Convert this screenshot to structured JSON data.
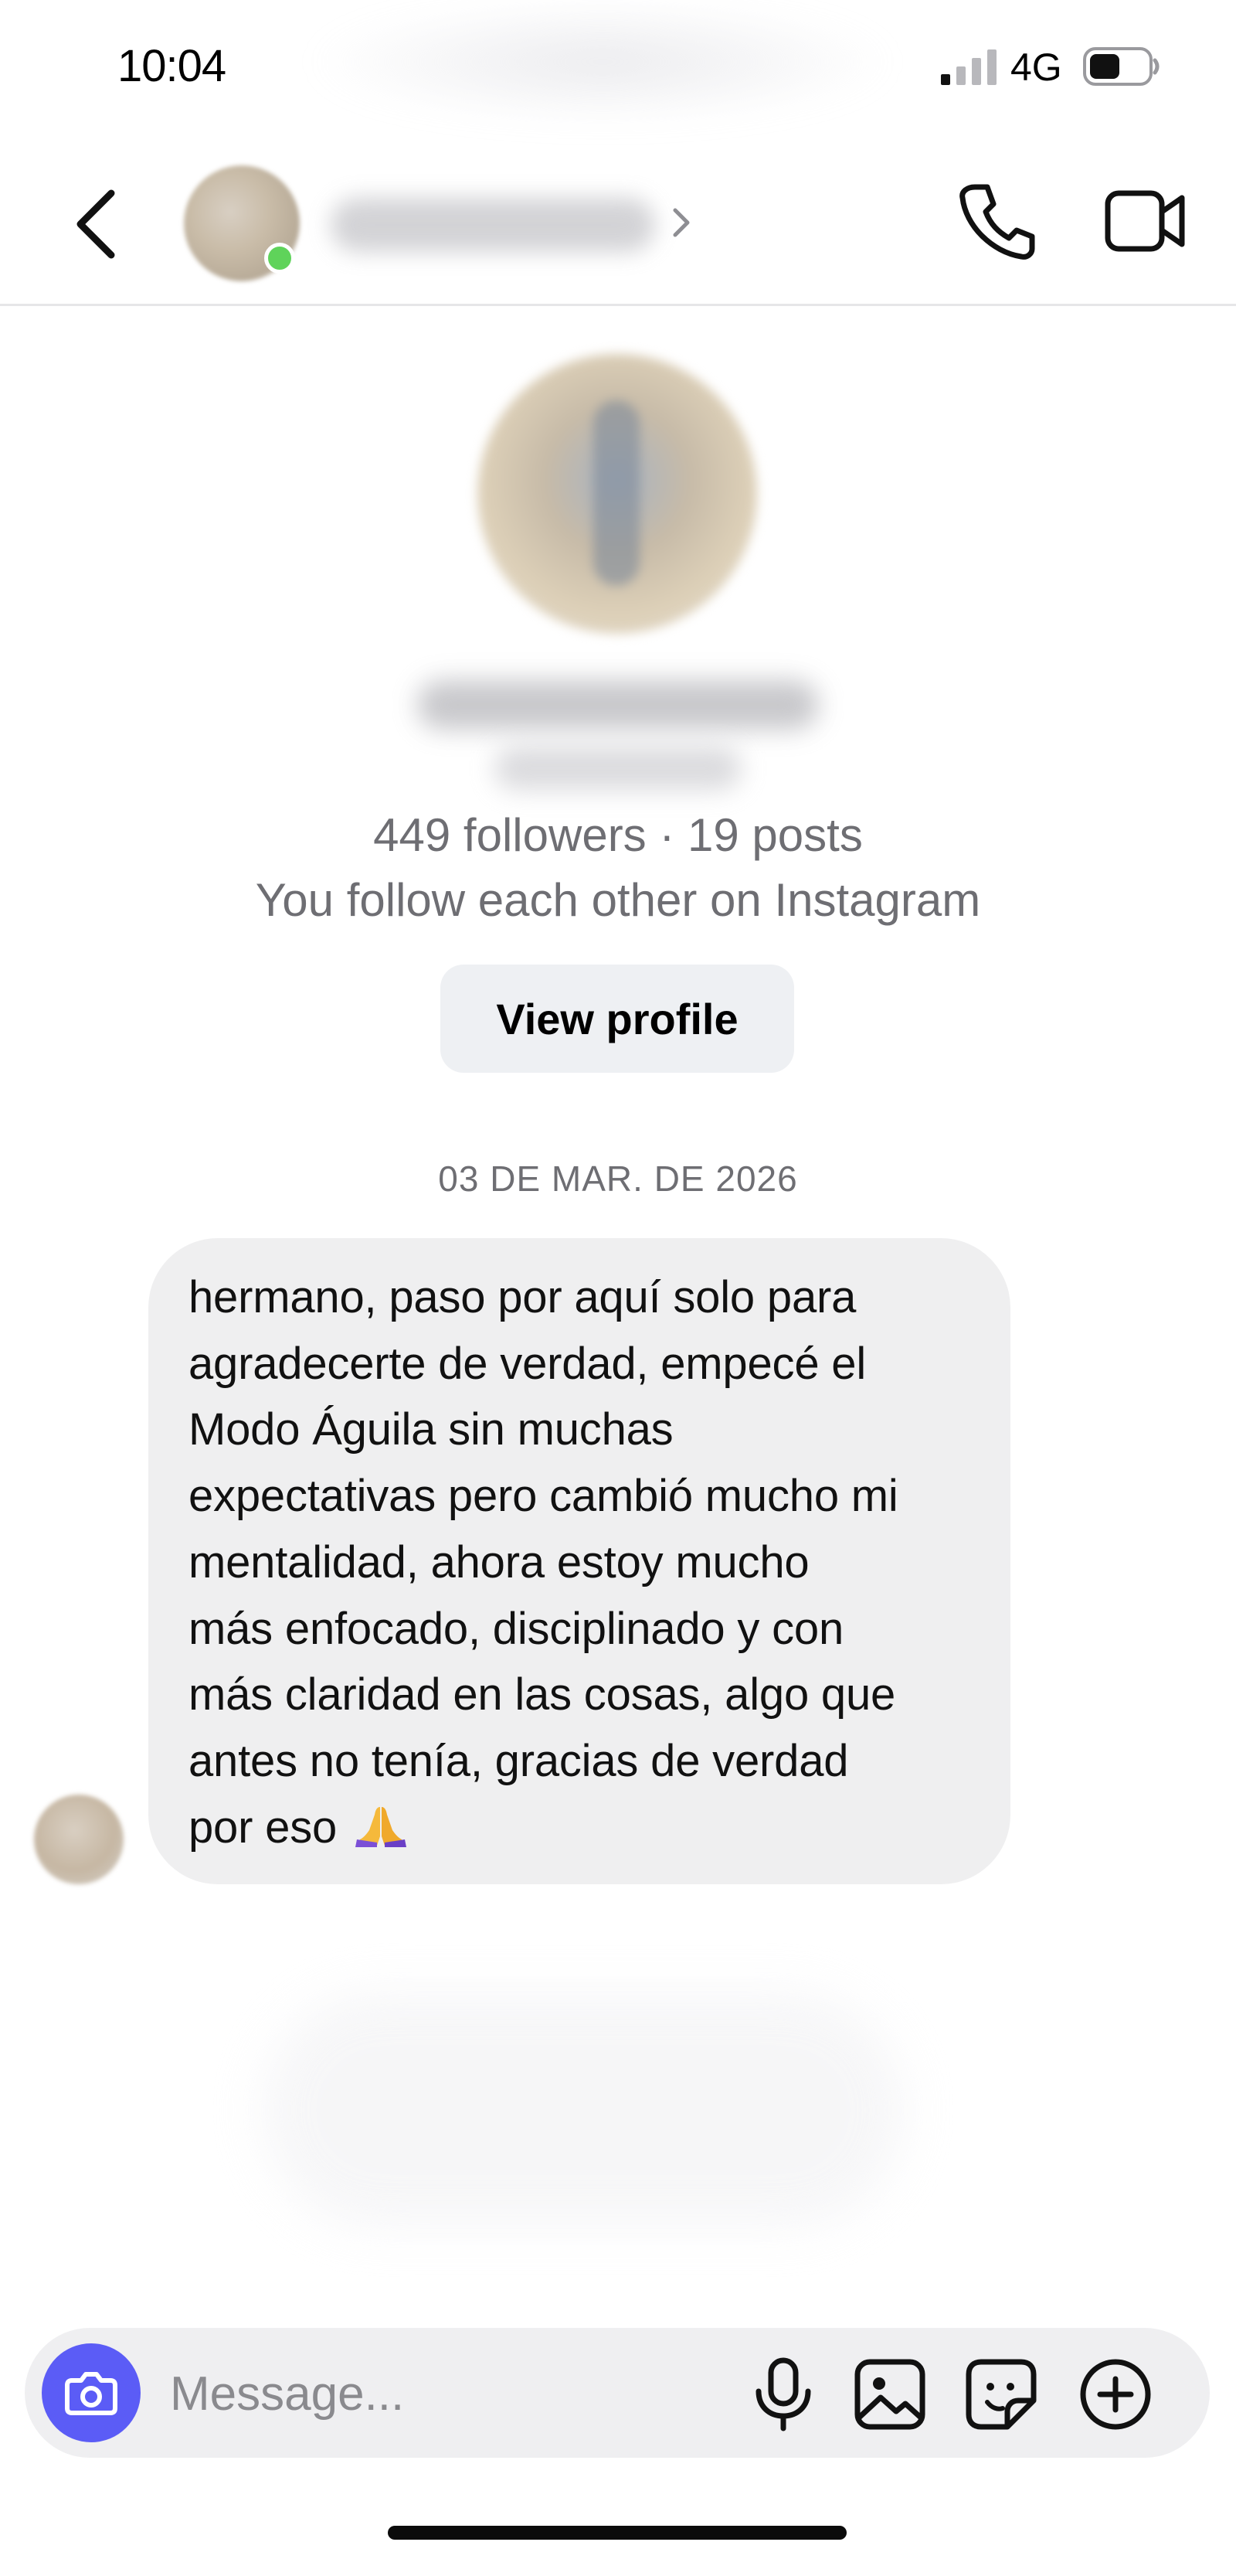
{
  "status_bar": {
    "time": "10:04",
    "network": "4G"
  },
  "header": {
    "contact_name": "",
    "icons": [
      "back-icon",
      "phone-icon",
      "video-icon"
    ]
  },
  "profile": {
    "stats": "449 followers · 19 posts",
    "mutual": "You follow each other on Instagram",
    "view_profile_label": "View profile"
  },
  "conversation": {
    "date": "03 DE MAR. DE 2026",
    "message": {
      "text": "hermano, paso por aquí solo para\nagradecerte de verdad, empecé el\nModo Águila sin muchas\nexpectativas pero cambió mucho mi\nmentalidad, ahora estoy mucho\nmás enfocado, disciplinado y con\nmás claridad en las cosas, algo que\nantes no tenía, gracias de verdad\npor eso ",
      "emoji": "folded-hands"
    }
  },
  "composer": {
    "placeholder": "Message...",
    "icons": [
      "camera-icon",
      "microphone-icon",
      "gallery-icon",
      "sticker-icon",
      "add-icon"
    ],
    "accent_color": "#5b5cf6"
  }
}
